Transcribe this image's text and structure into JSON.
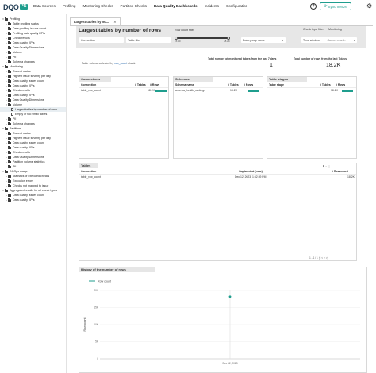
{
  "app": {
    "logo_main": "DQO",
    "logo_badge": "PS",
    "nav": [
      "Data Sources",
      "Profiling",
      "Monitoring Checks",
      "Partition Checks",
      "Data Quality Dashboards",
      "Incidents",
      "Configuration"
    ],
    "active_nav": "Data Quality Dashboards",
    "help_glyph": "?",
    "sync_label": "Synchronize",
    "gear_glyph": "⚙"
  },
  "sidebar": {
    "items": [
      {
        "label": "Profiling",
        "level": 0,
        "kind": "folder",
        "open": true
      },
      {
        "label": "Table profiling status",
        "level": 1,
        "kind": "folder"
      },
      {
        "label": "Data profiling issues count",
        "level": 1,
        "kind": "folder"
      },
      {
        "label": "Profiling data quality KPIs",
        "level": 1,
        "kind": "folder"
      },
      {
        "label": "Check results",
        "level": 1,
        "kind": "folder"
      },
      {
        "label": "Data quality KPIs",
        "level": 1,
        "kind": "folder"
      },
      {
        "label": "Data Quality Dimensions",
        "level": 1,
        "kind": "folder"
      },
      {
        "label": "Volume",
        "level": 1,
        "kind": "folder"
      },
      {
        "label": "PII",
        "level": 1,
        "kind": "folder"
      },
      {
        "label": "Schema changes",
        "level": 1,
        "kind": "folder"
      },
      {
        "label": "Monitoring",
        "level": 0,
        "kind": "folder",
        "open": true
      },
      {
        "label": "Current status",
        "level": 1,
        "kind": "folder"
      },
      {
        "label": "Highest issue severity per day",
        "level": 1,
        "kind": "folder"
      },
      {
        "label": "Data quality issues count",
        "level": 1,
        "kind": "folder"
      },
      {
        "label": "Data quality KPIs",
        "level": 1,
        "kind": "folder"
      },
      {
        "label": "Check results",
        "level": 1,
        "kind": "folder"
      },
      {
        "label": "Data quality KPIs",
        "level": 1,
        "kind": "folder"
      },
      {
        "label": "Data Quality Dimensions",
        "level": 1,
        "kind": "folder"
      },
      {
        "label": "Volume",
        "level": 1,
        "kind": "folder",
        "open": true
      },
      {
        "label": "Largest tables by number of rows",
        "level": 2,
        "kind": "doc",
        "selected": true
      },
      {
        "label": "Empty or too small tables",
        "level": 2,
        "kind": "doc"
      },
      {
        "label": "PII",
        "level": 1,
        "kind": "folder"
      },
      {
        "label": "Schema changes",
        "level": 1,
        "kind": "folder"
      },
      {
        "label": "Partitions",
        "level": 0,
        "kind": "folder",
        "open": true
      },
      {
        "label": "Current status",
        "level": 1,
        "kind": "folder"
      },
      {
        "label": "Highest issue severity per day",
        "level": 1,
        "kind": "folder"
      },
      {
        "label": "Data quality issues count",
        "level": 1,
        "kind": "folder"
      },
      {
        "label": "Data quality KPIs",
        "level": 1,
        "kind": "folder"
      },
      {
        "label": "Check results",
        "level": 1,
        "kind": "folder"
      },
      {
        "label": "Data Quality Dimensions",
        "level": 1,
        "kind": "folder"
      },
      {
        "label": "Partition volume statistics",
        "level": 1,
        "kind": "folder"
      },
      {
        "label": "PII",
        "level": 1,
        "kind": "folder"
      },
      {
        "label": "DQOps usage",
        "level": 0,
        "kind": "folder",
        "open": true
      },
      {
        "label": "Statistics of executed checks",
        "level": 1,
        "kind": "folder"
      },
      {
        "label": "Execution errors",
        "level": 1,
        "kind": "folder"
      },
      {
        "label": "Checks not mapped to issue",
        "level": 1,
        "kind": "folder"
      },
      {
        "label": "Aggregated results for all check types",
        "level": 0,
        "kind": "folder",
        "open": true
      },
      {
        "label": "Data quality issues count",
        "level": 1,
        "kind": "folder"
      },
      {
        "label": "Data quality KPIs",
        "level": 1,
        "kind": "folder"
      }
    ]
  },
  "tab": {
    "label": "Largest tables by nu...",
    "close": "✕"
  },
  "filters": {
    "title": "Largest tables by number of rows",
    "connection": "Connection",
    "table_filter": "Table filter",
    "row_count_filter": "Row count filter",
    "row_min": "15.40",
    "row_max": "18.2K",
    "data_group_name": "Data group name",
    "check_type_label": "Check type filter",
    "check_type_value": "Monitoring",
    "time_window": "Time window",
    "time_window_value": "Current month"
  },
  "summary": {
    "note_prefix": "Table volume collected by",
    "note_link": "row_count",
    "note_suffix": "check",
    "monitored_label": "Total number of monitored tables from the last 7 days",
    "monitored_value": "1",
    "rows_label": "Total number of rows from the last 7 days",
    "rows_value": "18.2K"
  },
  "connections_card": {
    "title": "Connections",
    "col1": "Connection",
    "col2": "# Tables",
    "col3": "# Rows",
    "rows": [
      {
        "name": "table_row_count",
        "tables": "1",
        "rows": "18.2K"
      }
    ]
  },
  "schemas_card": {
    "title": "Schemas",
    "col1": "Schema name",
    "col2": "# Tables",
    "col3": "# Rows",
    "rows": [
      {
        "name": "america_health_rankings",
        "tables": "1",
        "rows": "18.2K"
      }
    ]
  },
  "stages_card": {
    "title": "Table stages",
    "col1": "Table stage",
    "col2": "# Tables",
    "col3": "# Rows",
    "rows": [
      {
        "name": "",
        "tables": "1",
        "rows": "18.2K"
      }
    ]
  },
  "tables_card": {
    "title": "Tables",
    "col1": "Connection",
    "col2": "Captured at (max)",
    "col3": "# Row count",
    "rows": [
      {
        "name": "table_row_count",
        "captured": "Dec 12, 2023, 1:52:39 PM",
        "rows": "18.2K"
      }
    ],
    "pager": "1 - 1 / 1"
  },
  "chart_data": {
    "type": "line",
    "title": "History of the number of rows",
    "legend": [
      "Row count"
    ],
    "ylabel": "Row count",
    "xlabel": "",
    "x": [
      "Dec 12, 2023"
    ],
    "series": [
      {
        "name": "Row count",
        "values": [
          18200
        ],
        "color": "#1f9e8e"
      }
    ],
    "yticks": [
      "20K",
      "15K",
      "10K",
      "5K",
      "0"
    ],
    "ylim": [
      0,
      20000
    ],
    "grid": true,
    "legend_position": "top-left"
  }
}
